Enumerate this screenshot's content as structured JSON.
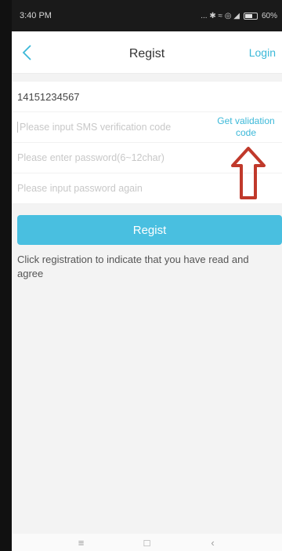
{
  "status_bar": {
    "time": "3:40 PM",
    "icons": "... ✱ ≈ ◎ ◢",
    "battery_text": "60%"
  },
  "nav": {
    "back_icon": "chevron-left-icon",
    "title": "Regist",
    "login_label": "Login"
  },
  "form": {
    "phone": "14151234567",
    "sms_placeholder": "Please input SMS verification code",
    "get_code_label": "Get validation code",
    "password_placeholder": "Please enter password(6~12char)",
    "confirm_placeholder": "Please input password again"
  },
  "regist_label": "Regist",
  "agree_text": "Click registration to indicate that you have read and agree",
  "annotation": {
    "arrow_icon": "arrow-up-icon",
    "arrow_color": "#c0392b"
  },
  "system_nav": {
    "menu_glyph": "≡",
    "home_glyph": "□",
    "back_glyph": "‹"
  },
  "colors": {
    "accent": "#3bb8d8",
    "button": "#49bfe0"
  }
}
